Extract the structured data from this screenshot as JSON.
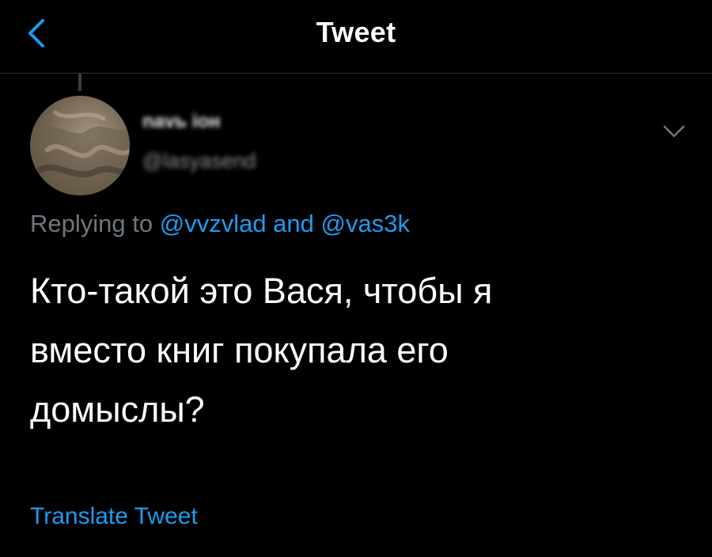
{
  "header": {
    "title": "Tweet",
    "back_icon": "chevron-left-icon"
  },
  "author": {
    "display_name": "nаvь іон",
    "handle": "@lasyasend"
  },
  "more_icon": "chevron-down-icon",
  "reply_context": {
    "prefix": "Replying to ",
    "mention_1": "@vvzvlad",
    "connector": " and ",
    "mention_2": "@vas3k"
  },
  "tweet": {
    "lines": [
      "Кто-такой это Вася, чтобы я",
      "вместо книг покупала его",
      "домыслы?"
    ]
  },
  "translate_label": "Translate Tweet",
  "colors": {
    "background": "#000000",
    "accent": "#1d9bf0",
    "muted": "#6e767d",
    "divider": "#2f3336"
  }
}
